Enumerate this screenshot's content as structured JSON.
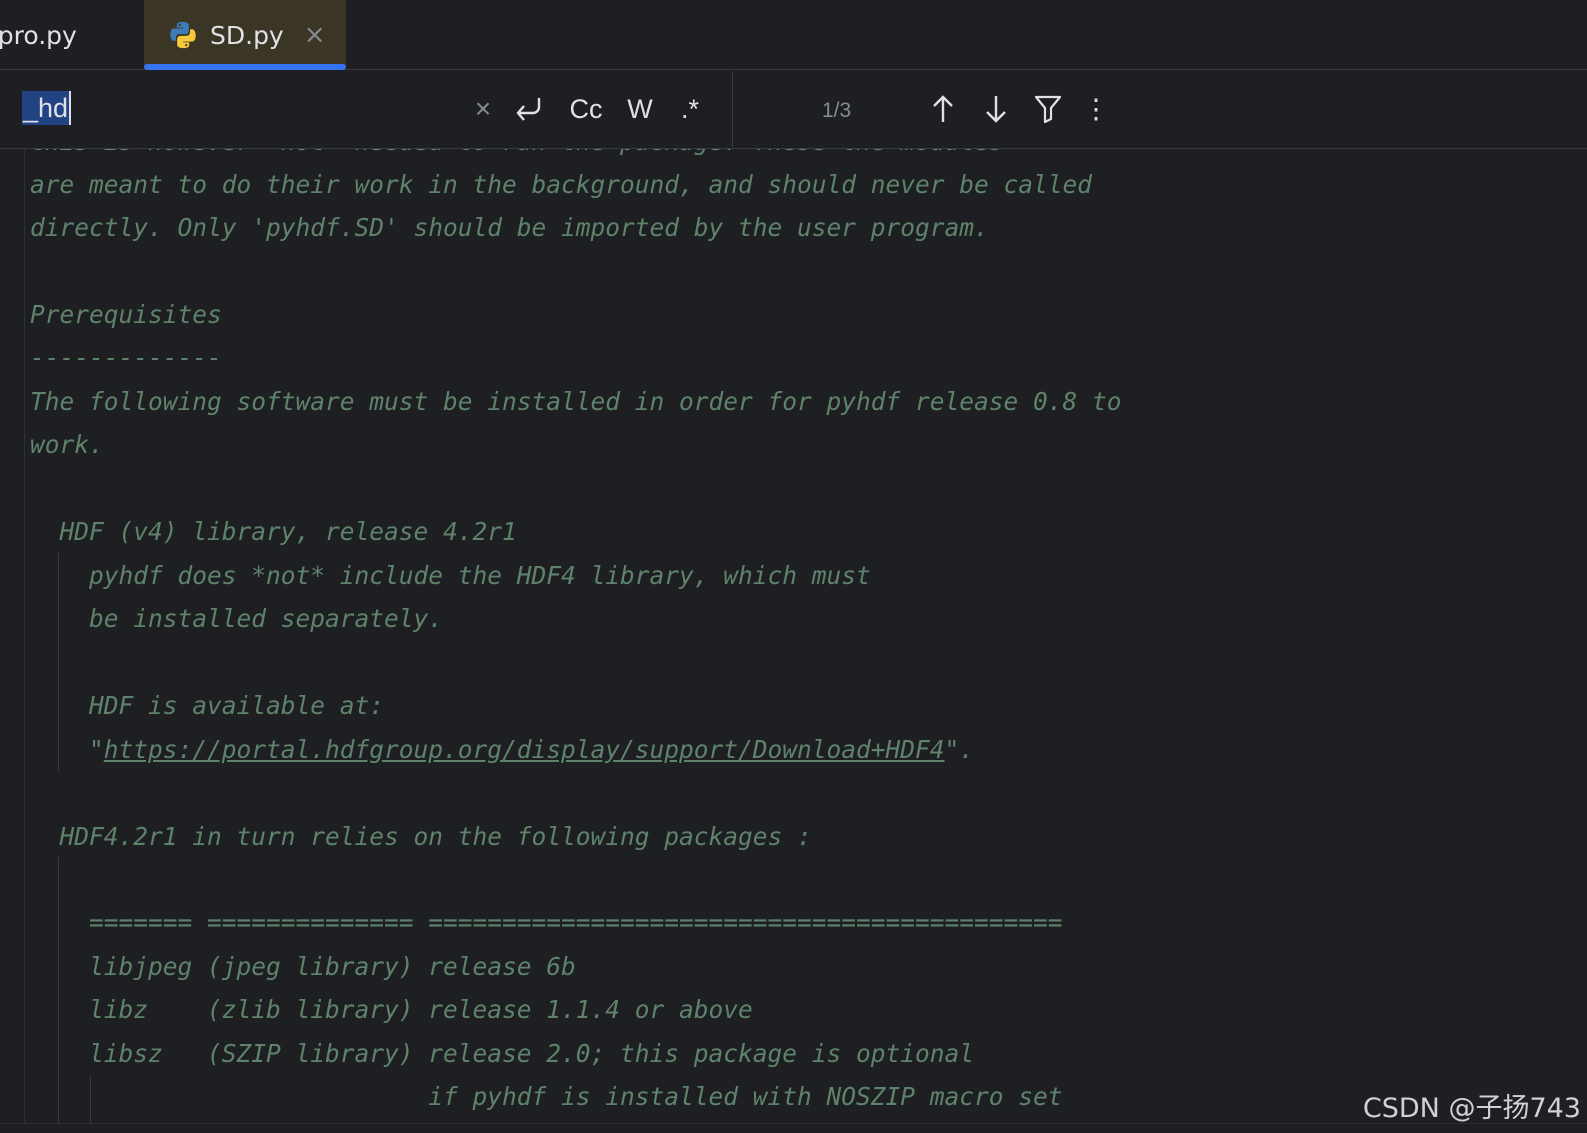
{
  "tabs": [
    {
      "label": "cpro.py",
      "active": false
    },
    {
      "label": "SD.py",
      "active": true,
      "close_glyph": "×",
      "icon": "python-icon"
    }
  ],
  "find_bar": {
    "query": "_hd",
    "clear_glyph": "×",
    "wrap_glyph": "⮐",
    "match_case_label": "Cc",
    "whole_words_label": "W",
    "regex_label": ".*",
    "match_count": "1/3",
    "prev_glyph": "↑",
    "next_glyph": "↓",
    "more_glyph": "⋮"
  },
  "editor": {
    "lines": [
      "this is however *not* needed to run the package. These the modules",
      "are meant to do their work in the background, and should never be called",
      "directly. Only 'pyhdf.SD' should be imported by the user program.",
      "",
      "Prerequisites",
      "-------------",
      "The following software must be installed in order for pyhdf release 0.8 to",
      "work.",
      "",
      "  HDF (v4) library, release 4.2r1",
      "    pyhdf does *not* include the HDF4 library, which must",
      "    be installed separately.",
      "",
      "    HDF is available at:",
      "URL_LINE",
      "",
      "  HDF4.2r1 in turn relies on the following packages :",
      "",
      "    ======= ============== ===========================================",
      "    libjpeg (jpeg library) release 6b",
      "    libz    (zlib library) release 1.1.4 or above",
      "    libsz   (SZIP library) release 2.0; this package is optional",
      "                           if pyhdf is installed with NOSZIP macro set"
    ],
    "url_line": {
      "prefix": "    \"",
      "link": "https://portal.hdfgroup.org/display/support/Download+HDF4",
      "suffix": "\"."
    }
  },
  "watermark": "CSDN @子扬743",
  "colors": {
    "background": "#1e1f22",
    "comment_text": "#5f826b",
    "active_tab_bg": "#3b3526",
    "active_tab_underline": "#3574f0",
    "search_highlight": "#214283"
  }
}
